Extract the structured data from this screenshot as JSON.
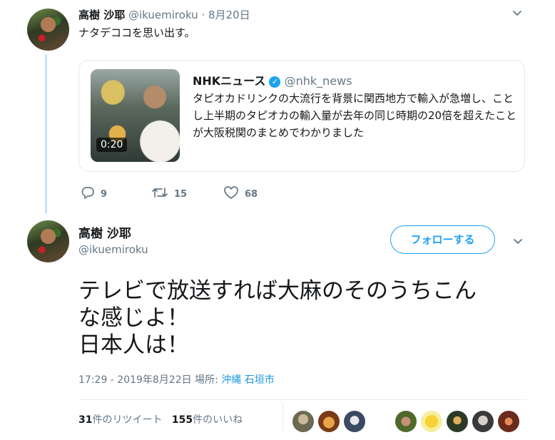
{
  "reply_tweet": {
    "author_name": "高樹 沙耶",
    "handle": "@ikuemiroku",
    "separator": "·",
    "date": "8月20日",
    "text": "ナタデココを思い出す。",
    "quoted": {
      "name": "NHKニュース",
      "verified_mark": "✓",
      "handle": "@nhk_news",
      "video_duration": "0:20",
      "text": "タピオカドリンクの大流行を背景に関西地方で輸入が急増し、ことし上半期のタピオカの輸入量が去年の同じ時期の20倍を超えたことが大阪税関のまとめでわかりました"
    },
    "actions": {
      "replies": "9",
      "retweets": "15",
      "likes": "68"
    }
  },
  "main_tweet": {
    "author_name": "高樹 沙耶",
    "handle": "@ikuemiroku",
    "follow_label": "フォローする",
    "text_lines": [
      "テレビで放送すれば大麻のそのうちこん",
      "な感じよ！",
      "日本人は！"
    ],
    "timestamp": "17:29 - 2019年8月22日",
    "location_label": "場所:",
    "location": "沖縄 石垣市",
    "retweet_count": "31",
    "retweet_label": "件のリツイート",
    "like_count": "155",
    "like_label": "件のいいね"
  },
  "icons": {
    "chevron": "chevron-down-icon",
    "reply": "reply-icon",
    "retweet": "retweet-icon",
    "like": "heart-icon"
  },
  "colors": {
    "accent": "#1da1f2",
    "link": "#1b95e0",
    "muted": "#657786",
    "thread_line": "#c4e3f7"
  }
}
